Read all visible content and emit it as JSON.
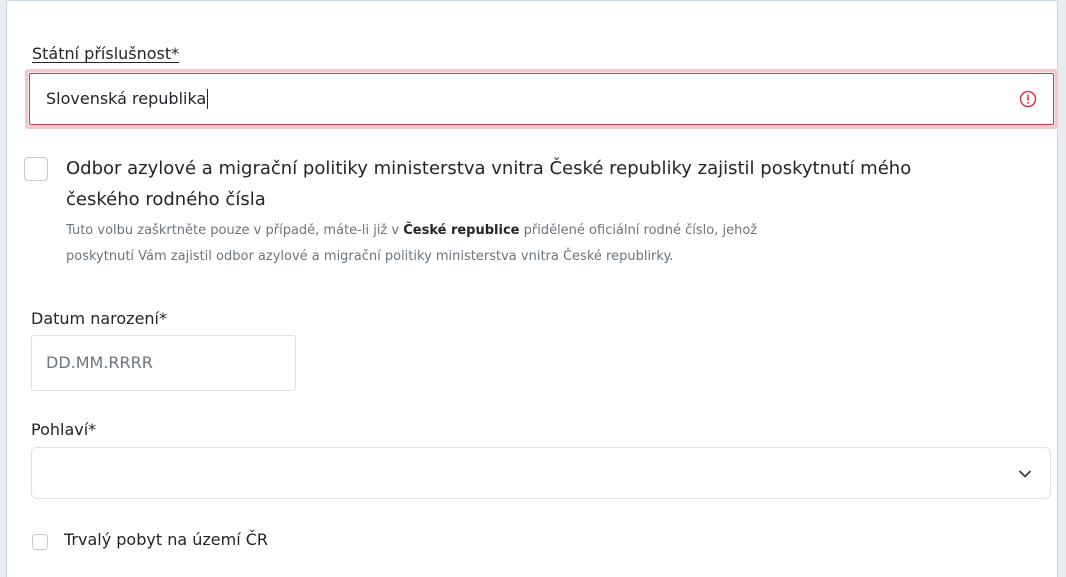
{
  "nationality": {
    "label": "Státní příslušnost*",
    "value": "Slovenská republika",
    "error_icon": "exclamation-circle-icon",
    "error_color": "#dc3545"
  },
  "birth_number_checkbox": {
    "checked": false,
    "label_line1": "Odbor azylové a migrační politiky ministerstva vnitra České republiky zajistil poskytnutí mého",
    "label_line2": "českého rodného čísla",
    "help_before": "Tuto volbu zaškrtněte pouze v případě, máte-li již v ",
    "help_bold": "České republice",
    "help_after": " přidělené oficiální rodné číslo, jehož",
    "help_line2": "poskytnutí Vám zajistil odbor azylové a migrační politiky ministerstva vnitra České republirky."
  },
  "birth_date": {
    "label": "Datum narození*",
    "placeholder": "DD.MM.RRRR"
  },
  "gender": {
    "label": "Pohlaví*",
    "value": "",
    "icon": "chevron-down-icon"
  },
  "permanent_residence": {
    "checked": false,
    "label": "Trvalý pobyt na území ČR"
  }
}
